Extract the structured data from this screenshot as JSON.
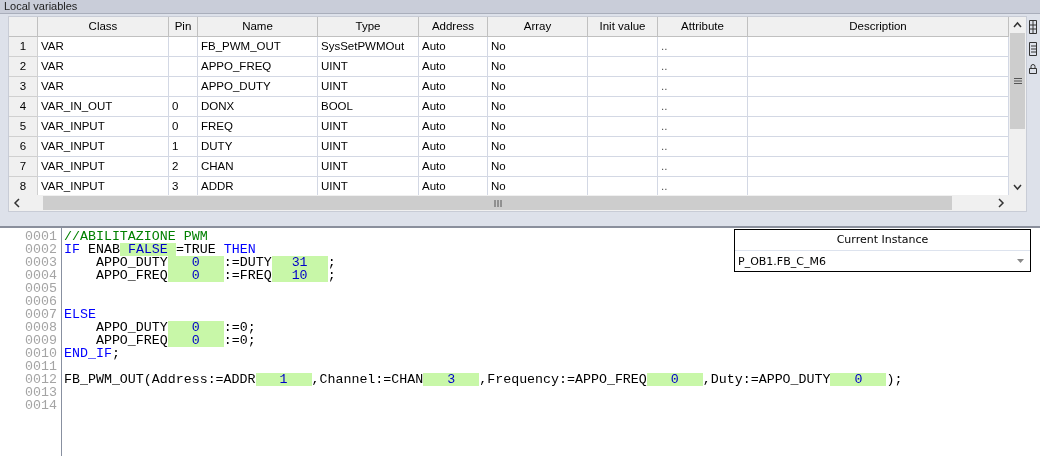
{
  "panel": {
    "title": "Local variables"
  },
  "table": {
    "columns": [
      "Class",
      "Pin",
      "Name",
      "Type",
      "Address",
      "Array",
      "Init value",
      "Attribute",
      "Description"
    ],
    "rows": [
      {
        "number": "1",
        "class": "VAR",
        "name": "FB_PWM_OUT",
        "type": "SysSetPWMOut",
        "address": "Auto",
        "array": "No",
        "attribute": ".."
      },
      {
        "number": "2",
        "class": "VAR",
        "name": "APPO_FREQ",
        "type": "UINT",
        "address": "Auto",
        "array": "No",
        "attribute": ".."
      },
      {
        "number": "3",
        "class": "VAR",
        "name": "APPO_DUTY",
        "type": "UINT",
        "address": "Auto",
        "array": "No",
        "attribute": ".."
      },
      {
        "number": "4",
        "class": "VAR_IN_OUT",
        "pin": "0",
        "name": "DONX",
        "type": "BOOL",
        "address": "Auto",
        "array": "No",
        "attribute": ".."
      },
      {
        "number": "5",
        "class": "VAR_INPUT",
        "pin": "0",
        "name": "FREQ",
        "type": "UINT",
        "address": "Auto",
        "array": "No",
        "attribute": ".."
      },
      {
        "number": "6",
        "class": "VAR_INPUT",
        "pin": "1",
        "name": "DUTY",
        "type": "UINT",
        "address": "Auto",
        "array": "No",
        "attribute": ".."
      },
      {
        "number": "7",
        "class": "VAR_INPUT",
        "pin": "2",
        "name": "CHAN",
        "type": "UINT",
        "address": "Auto",
        "array": "No",
        "attribute": ".."
      },
      {
        "number": "8",
        "class": "VAR_INPUT",
        "pin": "3",
        "name": "ADDR",
        "type": "UINT",
        "address": "Auto",
        "array": "No",
        "attribute": ".."
      }
    ]
  },
  "editor": {
    "lines": [
      {
        "number": "0001",
        "tokens": [
          {
            "kind": "comment",
            "text": "//ABILITAZIONE PWM"
          }
        ]
      },
      {
        "number": "0002",
        "tokens": [
          {
            "kind": "keyword",
            "text": "IF"
          },
          {
            "kind": "text",
            "text": " ENAB"
          },
          {
            "kind": "watch",
            "text": "FALSE"
          },
          {
            "kind": "text",
            "text": "=TRUE "
          },
          {
            "kind": "keyword",
            "text": "THEN"
          }
        ]
      },
      {
        "number": "0003",
        "tokens": [
          {
            "kind": "text",
            "text": "    APPO_DUTY"
          },
          {
            "kind": "watch",
            "text": "0"
          },
          {
            "kind": "text",
            "text": ":=DUTY"
          },
          {
            "kind": "watch",
            "text": "31"
          },
          {
            "kind": "text",
            "text": ";"
          }
        ]
      },
      {
        "number": "0004",
        "tokens": [
          {
            "kind": "text",
            "text": "    APPO_FREQ"
          },
          {
            "kind": "watch",
            "text": "0"
          },
          {
            "kind": "text",
            "text": ":=FREQ"
          },
          {
            "kind": "watch",
            "text": "10"
          },
          {
            "kind": "text",
            "text": ";"
          }
        ]
      },
      {
        "number": "0005"
      },
      {
        "number": "0006"
      },
      {
        "number": "0007",
        "tokens": [
          {
            "kind": "keyword",
            "text": "ELSE"
          }
        ]
      },
      {
        "number": "0008",
        "tokens": [
          {
            "kind": "text",
            "text": "    APPO_DUTY"
          },
          {
            "kind": "watch",
            "text": "0"
          },
          {
            "kind": "text",
            "text": ":=0;"
          }
        ]
      },
      {
        "number": "0009",
        "tokens": [
          {
            "kind": "text",
            "text": "    APPO_FREQ"
          },
          {
            "kind": "watch",
            "text": "0"
          },
          {
            "kind": "text",
            "text": ":=0;"
          }
        ]
      },
      {
        "number": "0010",
        "tokens": [
          {
            "kind": "keyword",
            "text": "END_IF"
          },
          {
            "kind": "text",
            "text": ";"
          }
        ]
      },
      {
        "number": "0011"
      },
      {
        "number": "0012",
        "tokens": [
          {
            "kind": "text",
            "text": "FB_PWM_OUT(Address:=ADDR"
          },
          {
            "kind": "watch",
            "text": "1"
          },
          {
            "kind": "text",
            "text": ",Channel:=CHAN"
          },
          {
            "kind": "watch",
            "text": "3"
          },
          {
            "kind": "text",
            "text": ",Frequency:=APPO_FREQ"
          },
          {
            "kind": "watch",
            "text": "0"
          },
          {
            "kind": "text",
            "text": ",Duty:=APPO_DUTY"
          },
          {
            "kind": "watch",
            "text": "0"
          },
          {
            "kind": "text",
            "text": ");"
          }
        ]
      },
      {
        "number": "0013"
      },
      {
        "number": "0014"
      }
    ]
  },
  "instance_panel": {
    "title": "Current Instance",
    "value": "P_OB1.FB_C_M6"
  }
}
